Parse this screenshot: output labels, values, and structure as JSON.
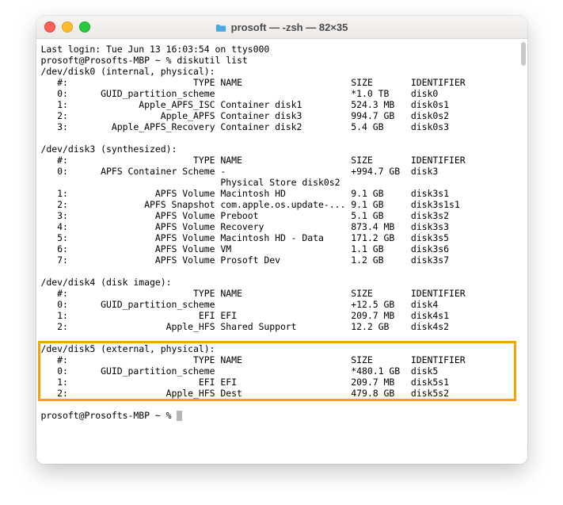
{
  "window": {
    "title": "prosoft — -zsh — 82×35"
  },
  "login_line": "Last login: Tue Jun 13 16:03:54 on ttys000",
  "prompt": "prosoft@Prosofts-MBP ~ %",
  "command": "diskutil list",
  "disks": [
    {
      "header": "/dev/disk0 (internal, physical):",
      "cols": {
        "num": "#:",
        "type": "TYPE",
        "name": "NAME",
        "size": "SIZE",
        "id": "IDENTIFIER"
      },
      "rows": [
        {
          "num": "0:",
          "type": "GUID_partition_scheme",
          "name": "",
          "size": "*1.0 TB",
          "id": "disk0"
        },
        {
          "num": "1:",
          "type": "Apple_APFS_ISC",
          "name": "Container disk1",
          "size": "524.3 MB",
          "id": "disk0s1"
        },
        {
          "num": "2:",
          "type": "Apple_APFS",
          "name": "Container disk3",
          "size": "994.7 GB",
          "id": "disk0s2"
        },
        {
          "num": "3:",
          "type": "Apple_APFS_Recovery",
          "name": "Container disk2",
          "size": "5.4 GB",
          "id": "disk0s3"
        }
      ]
    },
    {
      "header": "/dev/disk3 (synthesized):",
      "cols": {
        "num": "#:",
        "type": "TYPE",
        "name": "NAME",
        "size": "SIZE",
        "id": "IDENTIFIER"
      },
      "rows": [
        {
          "num": "0:",
          "type": "APFS Container Scheme",
          "name": "-",
          "size": "+994.7 GB",
          "id": "disk3"
        },
        {
          "num": "",
          "type": "",
          "name": "Physical Store disk0s2",
          "size": "",
          "id": ""
        },
        {
          "num": "1:",
          "type": "APFS Volume",
          "name": "Macintosh HD",
          "size": "9.1 GB",
          "id": "disk3s1"
        },
        {
          "num": "2:",
          "type": "APFS Snapshot",
          "name": "com.apple.os.update-...",
          "size": "9.1 GB",
          "id": "disk3s1s1"
        },
        {
          "num": "3:",
          "type": "APFS Volume",
          "name": "Preboot",
          "size": "5.1 GB",
          "id": "disk3s2"
        },
        {
          "num": "4:",
          "type": "APFS Volume",
          "name": "Recovery",
          "size": "873.4 MB",
          "id": "disk3s3"
        },
        {
          "num": "5:",
          "type": "APFS Volume",
          "name": "Macintosh HD - Data",
          "size": "171.2 GB",
          "id": "disk3s5"
        },
        {
          "num": "6:",
          "type": "APFS Volume",
          "name": "VM",
          "size": "1.1 GB",
          "id": "disk3s6"
        },
        {
          "num": "7:",
          "type": "APFS Volume",
          "name": "Prosoft Dev",
          "size": "1.2 GB",
          "id": "disk3s7"
        }
      ]
    },
    {
      "header": "/dev/disk4 (disk image):",
      "cols": {
        "num": "#:",
        "type": "TYPE",
        "name": "NAME",
        "size": "SIZE",
        "id": "IDENTIFIER"
      },
      "rows": [
        {
          "num": "0:",
          "type": "GUID_partition_scheme",
          "name": "",
          "size": "+12.5 GB",
          "id": "disk4"
        },
        {
          "num": "1:",
          "type": "EFI",
          "name": "EFI",
          "size": "209.7 MB",
          "id": "disk4s1"
        },
        {
          "num": "2:",
          "type": "Apple_HFS",
          "name": "Shared Support",
          "size": "12.2 GB",
          "id": "disk4s2"
        }
      ]
    },
    {
      "header": "/dev/disk5 (external, physical):",
      "cols": {
        "num": "#:",
        "type": "TYPE",
        "name": "NAME",
        "size": "SIZE",
        "id": "IDENTIFIER"
      },
      "rows": [
        {
          "num": "0:",
          "type": "GUID_partition_scheme",
          "name": "",
          "size": "*480.1 GB",
          "id": "disk5"
        },
        {
          "num": "1:",
          "type": "EFI",
          "name": "EFI",
          "size": "209.7 MB",
          "id": "disk5s1"
        },
        {
          "num": "2:",
          "type": "Apple_HFS",
          "name": "Dest",
          "size": "479.8 GB",
          "id": "disk5s2"
        }
      ]
    }
  ],
  "highlight_disk_index": 3
}
